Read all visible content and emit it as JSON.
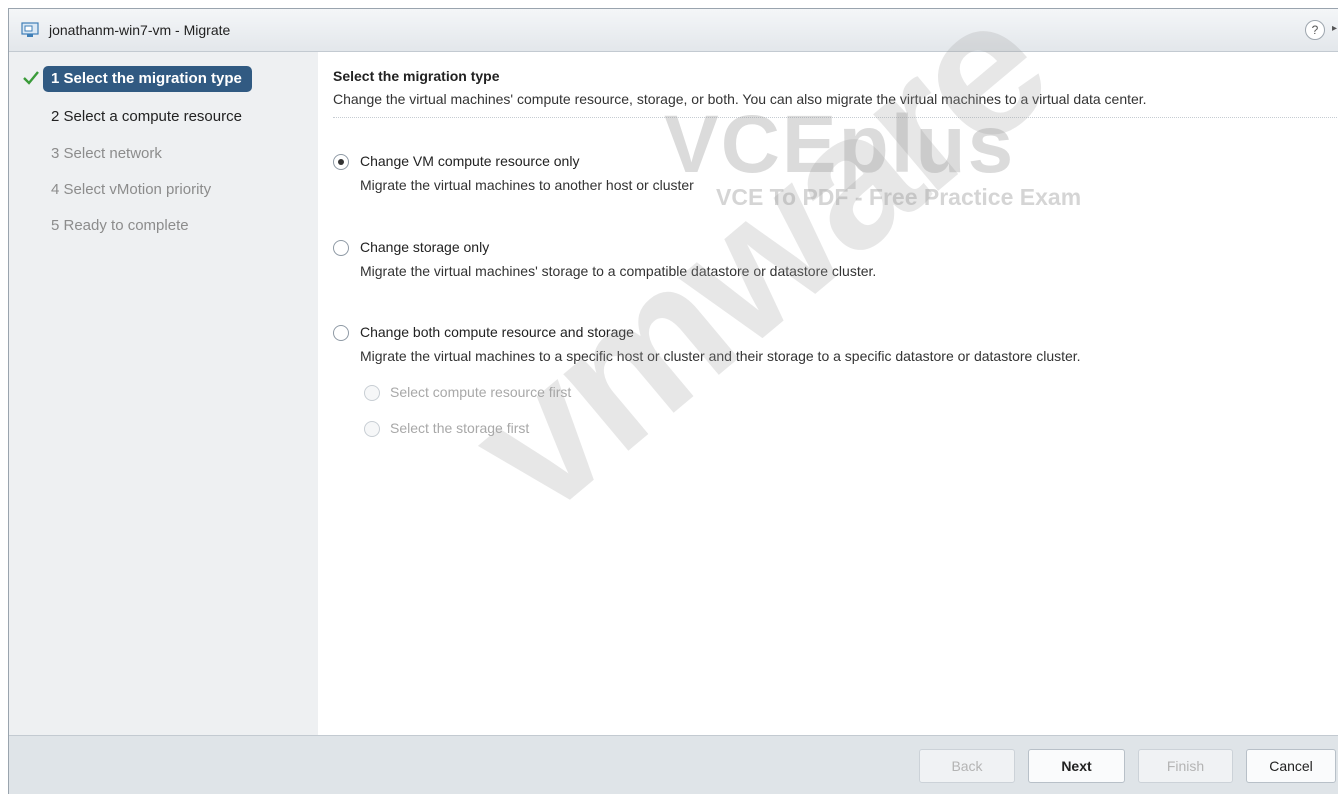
{
  "window": {
    "title": "jonathanm-win7-vm - Migrate",
    "help_glyph": "?",
    "expand_glyph": "▸"
  },
  "steps": [
    {
      "label": "1  Select the migration type",
      "state": "active"
    },
    {
      "label": "2  Select a compute resource",
      "state": "next"
    },
    {
      "label": "3  Select network",
      "state": "pending"
    },
    {
      "label": "4  Select vMotion priority",
      "state": "pending"
    },
    {
      "label": "5  Ready to complete",
      "state": "pending"
    }
  ],
  "main": {
    "title": "Select the migration type",
    "description": "Change the virtual machines' compute resource, storage, or both. You can also migrate the virtual machines to a virtual data center.",
    "options": [
      {
        "label": "Change VM compute resource only",
        "desc": "Migrate the virtual machines to another host or cluster",
        "selected": true
      },
      {
        "label": "Change storage only",
        "desc": "Migrate the virtual machines' storage to a compatible datastore or datastore cluster.",
        "selected": false
      },
      {
        "label": "Change both compute resource and storage",
        "desc": "Migrate the virtual machines to a specific host or cluster and their storage to a specific datastore or datastore cluster.",
        "selected": false
      }
    ],
    "sub_options": [
      {
        "label": "Select compute resource first",
        "enabled": false
      },
      {
        "label": "Select the storage first",
        "enabled": false
      }
    ]
  },
  "watermark": {
    "main": "VCEplus",
    "registered": "®",
    "sub": "VCE To PDF - Free Practice Exam",
    "brand": "vmware"
  },
  "footer": {
    "back": "Back",
    "next": "Next",
    "finish": "Finish",
    "cancel": "Cancel"
  },
  "colors": {
    "active_step_bg": "#315a82",
    "check": "#3a9b3a",
    "footer_bg": "#dfe4e8",
    "sidebar_bg": "#eef0f2"
  },
  "icons": [
    "vm-icon",
    "help-icon",
    "expand-icon",
    "check-icon"
  ]
}
